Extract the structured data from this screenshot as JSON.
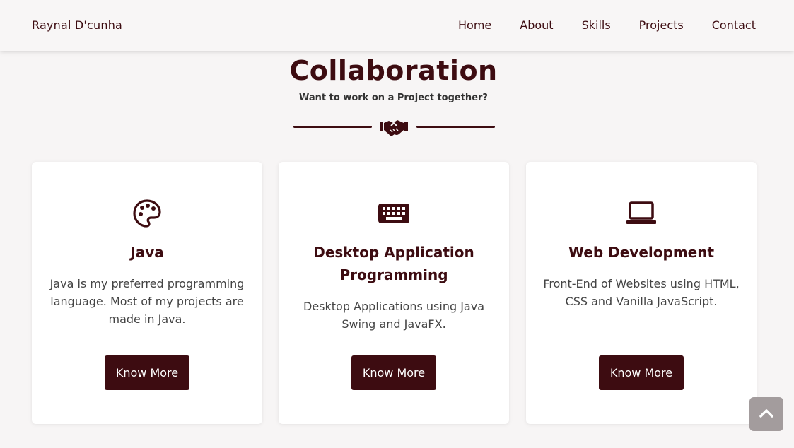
{
  "nav": {
    "brand": "Raynal D'cunha",
    "links": [
      "Home",
      "About",
      "Skills",
      "Projects",
      "Contact"
    ]
  },
  "section": {
    "title": "Collaboration",
    "subtitle": "Want to work on a Project together?",
    "divider_icon": "handshake-icon"
  },
  "cards": [
    {
      "icon": "palette-icon",
      "title": "Java",
      "text": "Java is my preferred programming language. Most of my projects are made in Java.",
      "button": "Know More"
    },
    {
      "icon": "keyboard-icon",
      "title": "Desktop Application Programming",
      "text": "Desktop Applications using Java Swing and JavaFX.",
      "button": "Know More"
    },
    {
      "icon": "laptop-icon",
      "title": "Web Development",
      "text": "Front-End of Websites using HTML, CSS and Vanilla JavaScript.",
      "button": "Know More"
    }
  ],
  "scroll_top_icon": "chevron-up-icon",
  "colors": {
    "primary": "#3d0c11",
    "background": "#f7f5f5",
    "card": "#ffffff",
    "scroll_button": "#a39c9d"
  }
}
